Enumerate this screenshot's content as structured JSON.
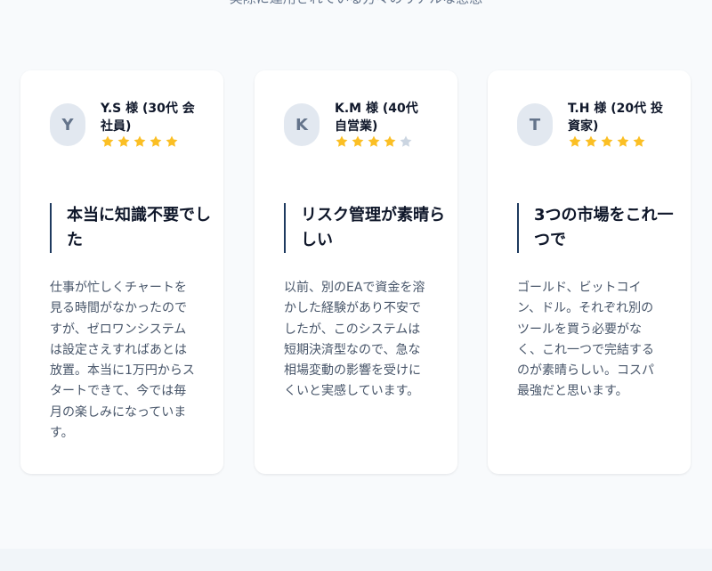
{
  "section": {
    "subtitle": "実際に運用されている方々のリアルな感想"
  },
  "colors": {
    "star_filled": "#fbbf24",
    "star_empty": "#cbd5e1",
    "accent_bar": "#1e3a5f",
    "card_bg": "#ffffff",
    "page_bg": "#f8fafc"
  },
  "testimonials": [
    {
      "initial": "Y",
      "name": "Y.S 様 (30代 会社員)",
      "rating": 5,
      "headline": "本当に知識不要でした",
      "body": "仕事が忙しくチャートを見る時間がなかったのですが、ゼロワンシステムは設定さえすればあとは放置。本当に1万円からスタートできて、今では毎月の楽しみになっています。"
    },
    {
      "initial": "K",
      "name": "K.M 様 (40代 自営業)",
      "rating": 4,
      "headline": "リスク管理が素晴らしい",
      "body": "以前、別のEAで資金を溶かした経験があり不安でしたが、このシステムは短期決済型なので、急な相場変動の影響を受けにくいと実感しています。"
    },
    {
      "initial": "T",
      "name": "T.H 様 (20代 投資家)",
      "rating": 5,
      "headline": "3つの市場をこれ一つで",
      "body": "ゴールド、ビットコイン、ドル。それぞれ別のツールを買う必要がなく、これ一つで完結するのが素晴らしい。コスパ最強だと思います。"
    }
  ]
}
